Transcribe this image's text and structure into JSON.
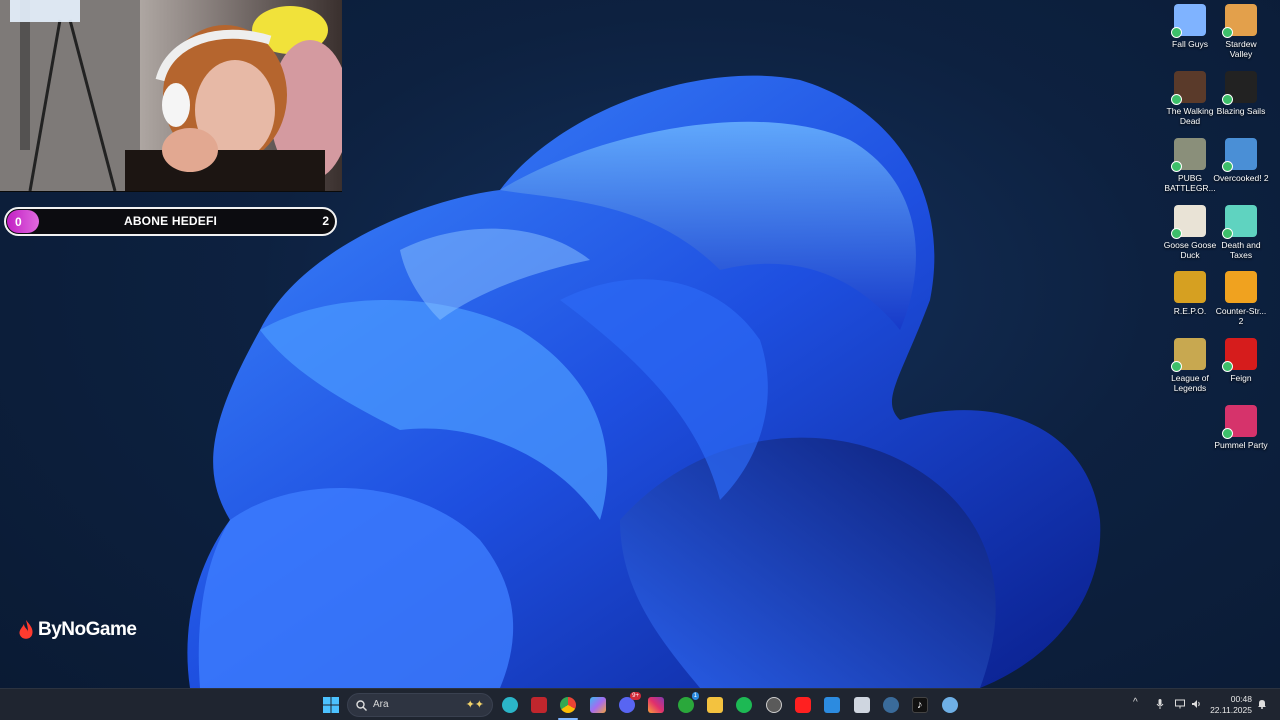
{
  "overlay": {
    "goal": {
      "current": "0",
      "title": "ABONE HEDEFI",
      "target": "2"
    },
    "brand": "ByNoGame"
  },
  "desktop_icons": [
    {
      "label": "Fall Guys",
      "icon": "fall-guys-icon",
      "color": "#7fb3ff"
    },
    {
      "label": "Stardew Valley",
      "icon": "stardew-valley-icon",
      "color": "#e3a04b"
    },
    {
      "label": "The Walking Dead",
      "icon": "walking-dead-icon",
      "color": "#5a3a2a"
    },
    {
      "label": "Blazing Sails",
      "icon": "epic-games-icon",
      "color": "#222222"
    },
    {
      "label": "PUBG BATTLEGR...",
      "icon": "pubg-icon",
      "color": "#8a8f7a"
    },
    {
      "label": "Overcooked! 2",
      "icon": "overcooked-icon",
      "color": "#4a8fd6"
    },
    {
      "label": "Goose Goose Duck",
      "icon": "goose-goose-duck-icon",
      "color": "#e9e3d6"
    },
    {
      "label": "Death and Taxes",
      "icon": "death-and-taxes-icon",
      "color": "#5fd3c0"
    },
    {
      "label": "R.E.P.O.",
      "icon": "repo-icon",
      "color": "#d6a021"
    },
    {
      "label": "Counter-Str... 2",
      "icon": "counter-strike-icon",
      "color": "#f0a21f"
    },
    {
      "label": "League of Legends",
      "icon": "league-of-legends-icon",
      "color": "#c8a850"
    },
    {
      "label": "Feign",
      "icon": "feign-icon",
      "color": "#d61c1c"
    },
    {
      "label": "Pummel Party",
      "icon": "pummel-party-icon",
      "color": "#d6336b"
    }
  ],
  "taskbar": {
    "search_placeholder": "Ara",
    "apps": [
      {
        "name": "start-button",
        "color": "#3aa0ff"
      },
      {
        "name": "edge-icon",
        "color": "#2bb5c8"
      },
      {
        "name": "app-red-icon",
        "color": "#c0262d"
      },
      {
        "name": "chrome-icon",
        "color": "#e8b22a"
      },
      {
        "name": "copilot-icon",
        "color": "#7a6cf0"
      },
      {
        "name": "discord-icon",
        "color": "#5865f2"
      },
      {
        "name": "instagram-icon",
        "color": "#e1306c"
      },
      {
        "name": "xbox-icon",
        "color": "#2aa83b"
      },
      {
        "name": "file-explorer-icon",
        "color": "#f3c23f"
      },
      {
        "name": "spotify-icon",
        "color": "#1db954"
      },
      {
        "name": "obs-icon",
        "color": "#5a5a5a"
      },
      {
        "name": "youtube-icon",
        "color": "#ff2020"
      },
      {
        "name": "mail-icon",
        "color": "#2c8be0"
      },
      {
        "name": "notepad-icon",
        "color": "#cfd6e0"
      },
      {
        "name": "steam-icon",
        "color": "#3a6b9a"
      },
      {
        "name": "tiktok-icon",
        "color": "#111111"
      },
      {
        "name": "settings-app-icon",
        "color": "#6fb0e6"
      }
    ],
    "discord_badge": "9+",
    "xbox_badge": "1",
    "time": "00:48",
    "date": "22.11.2025"
  }
}
